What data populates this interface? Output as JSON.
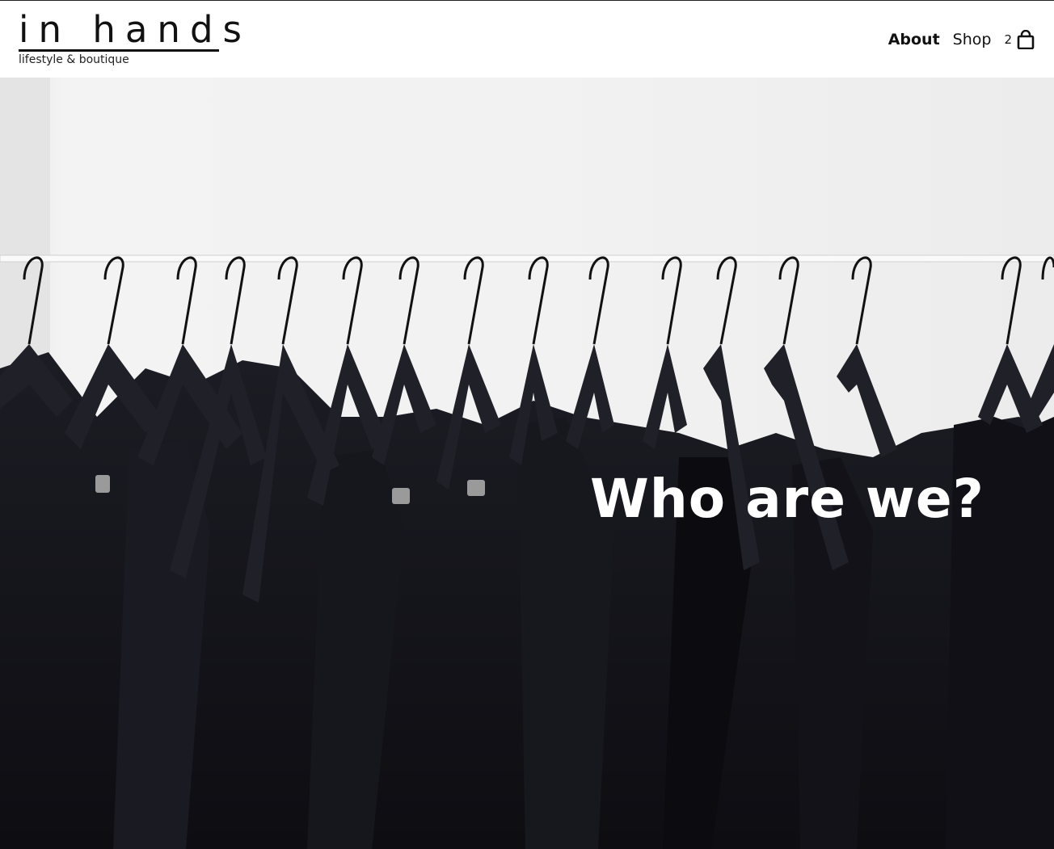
{
  "header": {
    "logo_title": "in hands",
    "logo_subtitle": "lifestyle & boutique"
  },
  "nav": {
    "about": "About",
    "shop": "Shop",
    "cart_count": "2",
    "cart_icon": "shopping-bag-icon"
  },
  "hero": {
    "heading": "Who are we?",
    "image": "clothing-rack-photo"
  },
  "colors": {
    "text": "#111111",
    "background": "#ffffff",
    "hero_wall": "#eeeeee",
    "garments": "#15151c",
    "heading": "#ffffff"
  }
}
